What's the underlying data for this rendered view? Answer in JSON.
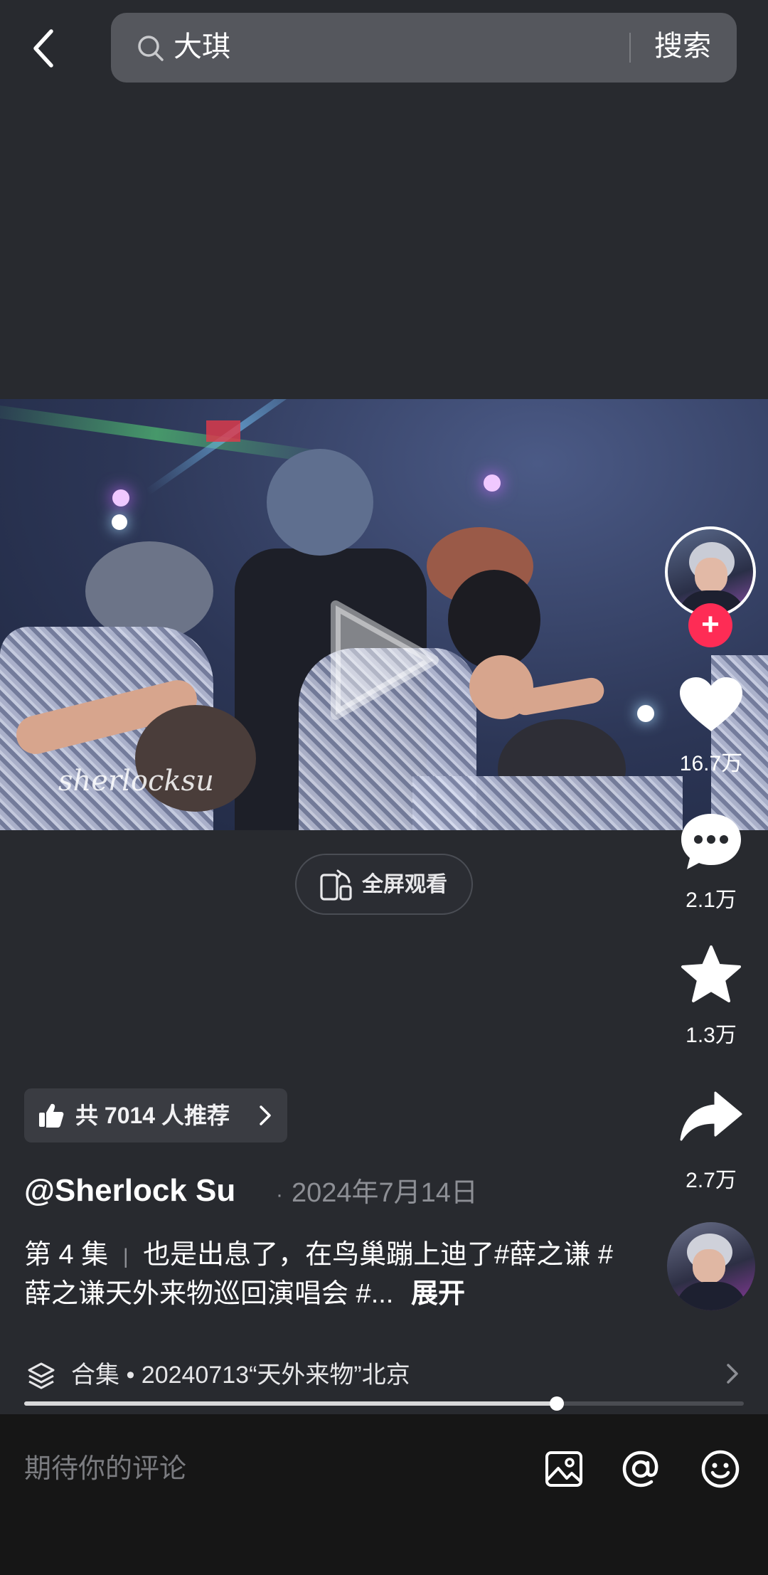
{
  "search": {
    "query": "大琪",
    "button_label": "搜索"
  },
  "video": {
    "watermark": "sherlocksu"
  },
  "fullscreen": {
    "label": "全屏观看"
  },
  "rail": {
    "likes": "16.7万",
    "comments": "2.1万",
    "favorites": "1.3万",
    "shares": "2.7万",
    "follow_symbol": "+"
  },
  "recommend": {
    "label": "共 7014 人推荐"
  },
  "post": {
    "author": "@Sherlock Su",
    "date_separator": "·",
    "date": "2024年7月14日",
    "episode": "第 4 集",
    "caption_separator": "|",
    "caption": "也是出息了，在鸟巢蹦上迪了#薛之谦 #薛之谦天外来物巡回演唱会 #...",
    "expand_label": "展开"
  },
  "collection": {
    "label": "合集 • 20240713“天外来物”北京"
  },
  "playback": {
    "progress": 0.74
  },
  "comment_bar": {
    "placeholder": "期待你的评论"
  },
  "colors": {
    "background": "#282a2f",
    "accent_red": "#fe2c55",
    "secondary_text": "#8d8f95"
  },
  "icons": {
    "back": "chevron-left-icon",
    "search": "search-icon",
    "like": "heart-icon",
    "comment": "speech-bubble-icon",
    "favorite": "star-icon",
    "share": "share-arrow-icon",
    "recommend": "thumbs-up-icon",
    "collection": "layers-icon",
    "image": "image-icon",
    "mention": "at-sign-icon",
    "emoji": "emoji-icon"
  }
}
